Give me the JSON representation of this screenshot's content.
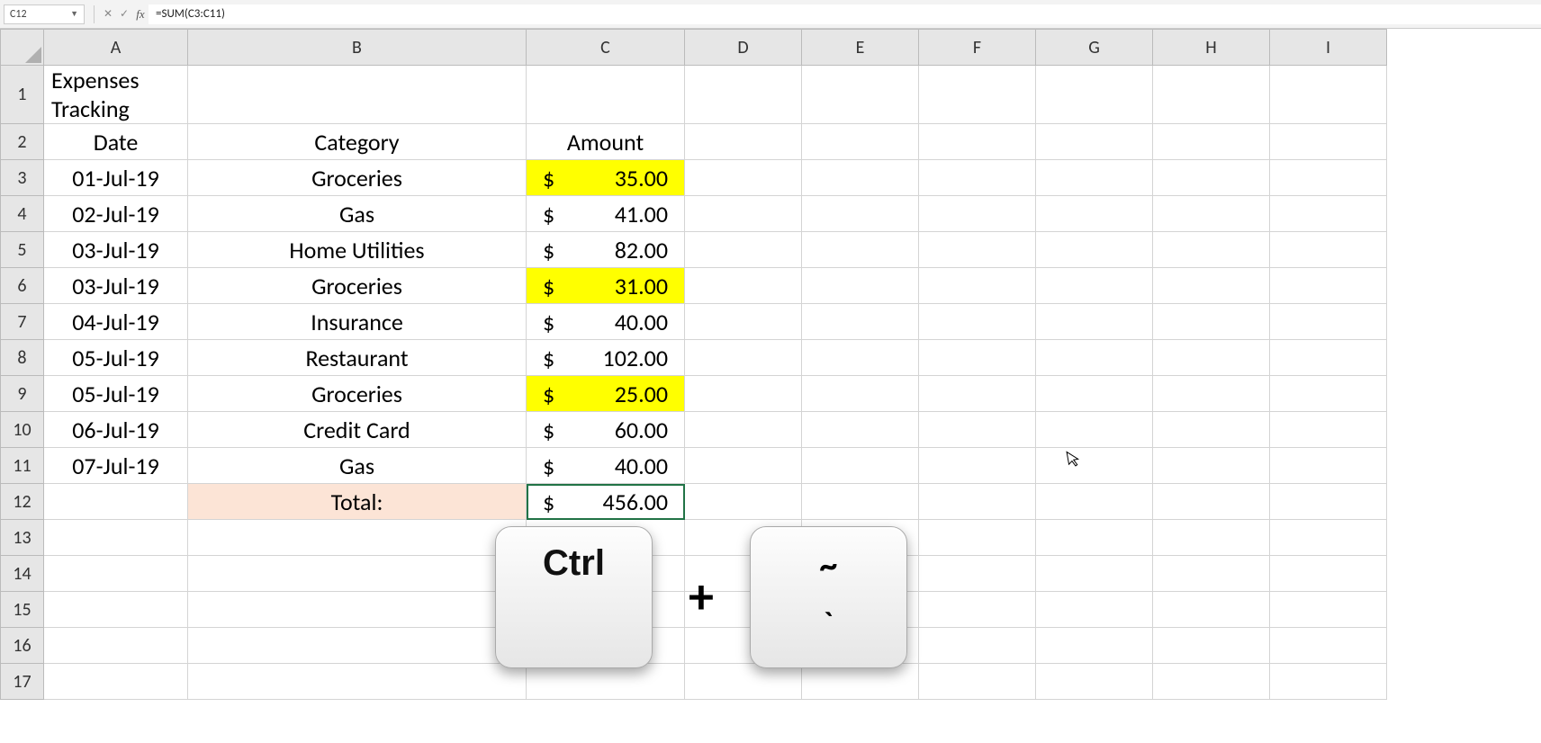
{
  "formula_bar": {
    "cell_ref": "C12",
    "formula": "=SUM(C3:C11)"
  },
  "columns": [
    "A",
    "B",
    "C",
    "D",
    "E",
    "F",
    "G",
    "H",
    "I"
  ],
  "rows_visible": 17,
  "sheet": {
    "title": "Expenses Tracking",
    "headers": {
      "date": "Date",
      "category": "Category",
      "amount": "Amount"
    },
    "entries": [
      {
        "date": "01-Jul-19",
        "category": "Groceries",
        "currency": "$",
        "amount": "35.00",
        "highlight": true
      },
      {
        "date": "02-Jul-19",
        "category": "Gas",
        "currency": "$",
        "amount": "41.00",
        "highlight": false
      },
      {
        "date": "03-Jul-19",
        "category": "Home Utilities",
        "currency": "$",
        "amount": "82.00",
        "highlight": false
      },
      {
        "date": "03-Jul-19",
        "category": "Groceries",
        "currency": "$",
        "amount": "31.00",
        "highlight": true
      },
      {
        "date": "04-Jul-19",
        "category": "Insurance",
        "currency": "$",
        "amount": "40.00",
        "highlight": false
      },
      {
        "date": "05-Jul-19",
        "category": "Restaurant",
        "currency": "$",
        "amount": "102.00",
        "highlight": false
      },
      {
        "date": "05-Jul-19",
        "category": "Groceries",
        "currency": "$",
        "amount": "25.00",
        "highlight": true
      },
      {
        "date": "06-Jul-19",
        "category": "Credit Card",
        "currency": "$",
        "amount": "60.00",
        "highlight": false
      },
      {
        "date": "07-Jul-19",
        "category": "Gas",
        "currency": "$",
        "amount": "40.00",
        "highlight": false
      }
    ],
    "total_label": "Total:",
    "total_currency": "$",
    "total_amount": "456.00"
  },
  "overlay": {
    "key1": "Ctrl",
    "plus": "+",
    "key2_top": "~",
    "key2_bot": "`"
  }
}
